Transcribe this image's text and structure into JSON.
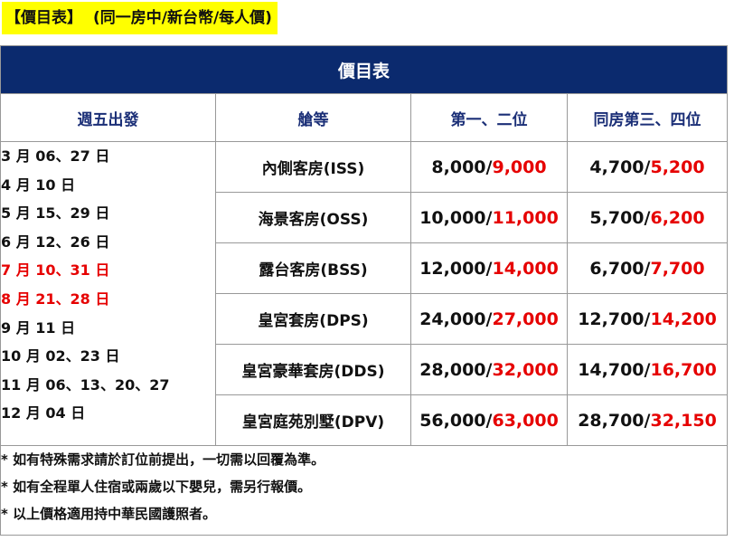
{
  "heading": {
    "tag": "【價目表】",
    "subtitle": "(同一房中/新台幣/每人價)"
  },
  "table": {
    "title": "價目表",
    "headers": [
      "週五出發",
      "艙等",
      "第一、二位",
      "同房第三、四位"
    ],
    "departures": [
      {
        "text": "3 月 06、27 日",
        "color": "#111111"
      },
      {
        "text": "4 月 10 日",
        "color": "#111111"
      },
      {
        "text": "5 月 15、29 日",
        "color": "#111111"
      },
      {
        "text": "6 月 12、26 日",
        "color": "#111111"
      },
      {
        "text": "7 月 10、31 日",
        "color": "#e60000"
      },
      {
        "text": "8 月 21、28 日",
        "color": "#e60000"
      },
      {
        "text": "9 月 11 日",
        "color": "#111111"
      },
      {
        "text": "10 月 02、23 日",
        "color": "#111111"
      },
      {
        "text": "11 月 06、13、20、27",
        "color": "#111111"
      },
      {
        "text": "12 月 04 日",
        "color": "#111111"
      }
    ],
    "rows": [
      {
        "cabin": "內側客房(ISS)",
        "p12_base": "8,000/",
        "p12_peak": "9,000",
        "p34_base": "4,700/",
        "p34_peak": "5,200"
      },
      {
        "cabin": "海景客房(OSS)",
        "p12_base": "10,000/",
        "p12_peak": "11,000",
        "p34_base": "5,700/",
        "p34_peak": "6,200"
      },
      {
        "cabin": "露台客房(BSS)",
        "p12_base": "12,000/",
        "p12_peak": "14,000",
        "p34_base": "6,700/",
        "p34_peak": "7,700"
      },
      {
        "cabin": "皇宮套房(DPS)",
        "p12_base": "24,000/",
        "p12_peak": "27,000",
        "p34_base": "12,700/",
        "p34_peak": "14,200"
      },
      {
        "cabin": "皇宮豪華套房(DDS)",
        "p12_base": "28,000/",
        "p12_peak": "32,000",
        "p34_base": "14,700/",
        "p34_peak": "16,700"
      },
      {
        "cabin": "皇宮庭苑別墅(DPV)",
        "p12_base": "56,000/",
        "p12_peak": "63,000",
        "p34_base": "28,700/",
        "p34_peak": "32,150"
      }
    ],
    "notes": [
      "* 如有特殊需求請於訂位前提出，一切需以回覆為準。",
      "* 如有全程單人住宿或兩歲以下嬰兒，需另行報價。",
      "* 以上價格適用持中華民國護照者。"
    ]
  },
  "colors": {
    "title_bg": "#0b2a6e",
    "header_text": "#1b2f77",
    "highlight": "#ffff00",
    "peak_price": "#e60000"
  }
}
